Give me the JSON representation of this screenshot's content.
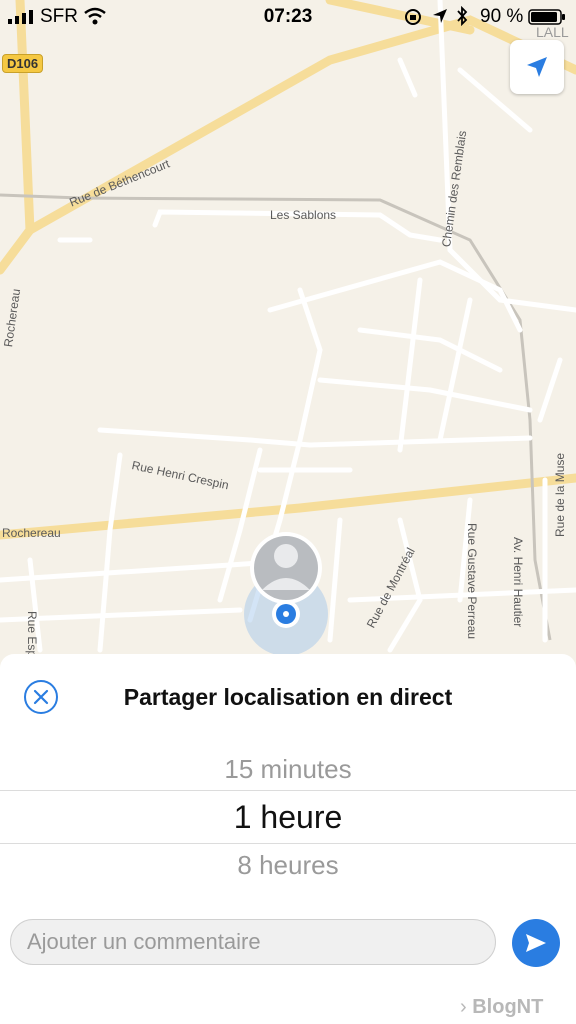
{
  "status_bar": {
    "carrier": "SFR",
    "time": "07:23",
    "battery": "90 %"
  },
  "map": {
    "road_badge": "D106",
    "streets": {
      "bethencourt": "Rue de Béthencourt",
      "sablons": "Les Sablons",
      "remblais": "Chemin des Remblais",
      "rochereau_left": "Rochereau",
      "henri_crespin": "Rue Henri Crespin",
      "rochereau_bottom": "Rochereau",
      "montreal": "Rue de Montréal",
      "gustave": "Rue Gustave Perreau",
      "hautier": "Av. Henri Hautier",
      "muse": "Rue de la Muse",
      "esp": "Rue Esp",
      "lalle": "LALL"
    }
  },
  "sheet": {
    "title": "Partager localisation en direct",
    "picker": {
      "above": "15 minutes",
      "selected": "1 heure",
      "below": "8 heures"
    },
    "comment_placeholder": "Ajouter un commentaire",
    "watermark": "BlogNT"
  }
}
